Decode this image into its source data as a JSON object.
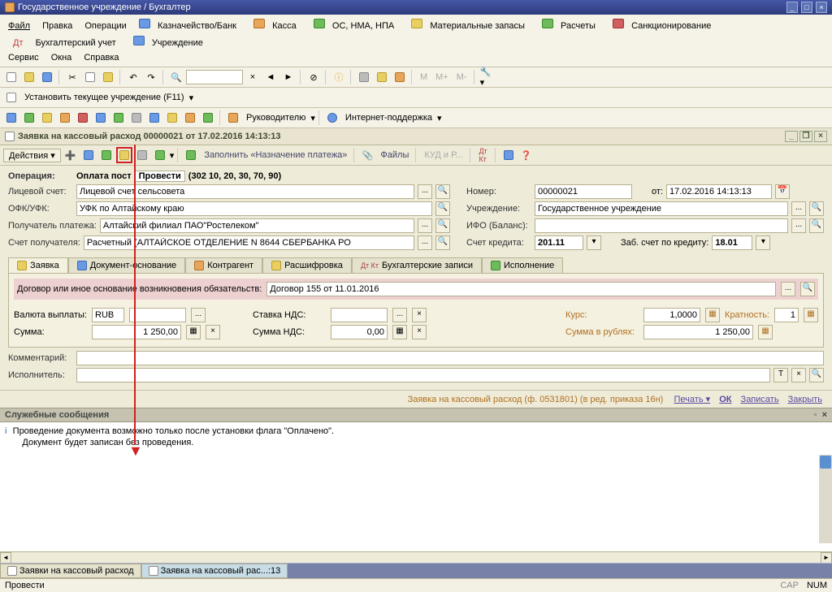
{
  "app_title": "Государственное учреждение / Бухгалтер",
  "main_menu": [
    "Файл",
    "Правка",
    "Операции",
    "Казначейство/Банк",
    "Касса",
    "ОС, НМА, НПА",
    "Материальные запасы",
    "Расчеты",
    "Санкционирование",
    "Бухгалтерский учет",
    "Учреждение",
    "Сервис",
    "Окна",
    "Справка"
  ],
  "tb2": {
    "set_inst": "Установить текущее учреждение (F11)"
  },
  "tb3": {
    "rukovod": "Руководителю",
    "inet": "Интернет-поддержка"
  },
  "doc": {
    "title": "Заявка на кассовый расход 00000021 от 17.02.2016 14:13:13",
    "actions": "Действия",
    "fill": "Заполнить «Назначение платежа»",
    "files": "Файлы",
    "kudr": "КУД и Р...",
    "operation_label": "Операция:",
    "operation_val": "Оплата пост",
    "operation_btn": "Провести",
    "operation_code": "(302 10, 20, 30, 70, 90)",
    "lschet_label": "Лицевой счет:",
    "lschet_val": "Лицевой счет сельсовета",
    "ofk_label": "ОФК/УФК:",
    "ofk_val": "УФК по Алтайскому краю",
    "recip_label": "Получатель платежа:",
    "recip_val": "Алтайский филиал ПАО\"Ростелеком\"",
    "acct_label": "Счет получателя:",
    "acct_val": "Расчетный (АЛТАЙСКОЕ ОТДЕЛЕНИЕ N 8644 СБЕРБАНКА РО",
    "num_label": "Номер:",
    "num_val": "00000021",
    "date_label": "от:",
    "date_val": "17.02.2016 14:13:13",
    "org_label": "Учреждение:",
    "org_val": "Государственное учреждение",
    "ifo_label": "ИФО (Баланс):",
    "ifo_val": "",
    "credit_label": "Счет кредита:",
    "credit_val": "201.11",
    "zab_label": "Заб. счет по кредиту:",
    "zab_val": "18.01"
  },
  "tabs": {
    "t1": "Заявка",
    "t2": "Документ-основание",
    "t3": "Контрагент",
    "t4": "Расшифровка",
    "t5": "Бухгалтерские записи",
    "t6": "Исполнение"
  },
  "band": {
    "label": "Договор или иное основание возникновения обязательств:",
    "val": "Договор 155 от 11.01.2016"
  },
  "nums": {
    "currency_label": "Валюта выплаты:",
    "currency_val": "RUB",
    "rate_label": "Ставка НДС:",
    "rate_val": "",
    "sum_label": "Сумма:",
    "sum_val": "1 250,00",
    "sumnds_label": "Сумма НДС:",
    "sumnds_val": "0,00",
    "kurs_label": "Курс:",
    "kurs_val": "1,0000",
    "krat_label": "Кратность:",
    "krat_val": "1",
    "rub_label": "Сумма в рублях:",
    "rub_val": "1 250,00"
  },
  "comment_label": "Комментарий:",
  "exec_label": "Исполнитель:",
  "footer": {
    "info": "Заявка на кассовый расход (ф. 0531801) (в ред. приказа 16н)",
    "print": "Печать",
    "ok": "ОК",
    "save": "Записать",
    "close": "Закрыть"
  },
  "svc": {
    "hdr": "Служебные сообщения",
    "line1": "Проведение документа возможно только после установки флага \"Оплачено\".",
    "line2": "       Документ будет записан без проведения."
  },
  "btabs": {
    "t1": "Заявки на кассовый расход",
    "t2": "Заявка на кассовый рас...:13"
  },
  "status": {
    "action": "Провести",
    "cap": "CAP",
    "num": "NUM"
  }
}
